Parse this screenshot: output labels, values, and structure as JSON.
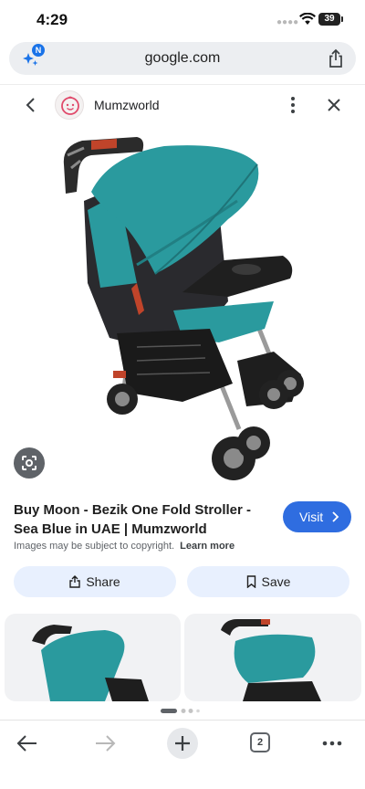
{
  "status_bar": {
    "time": "4:29",
    "battery": "39"
  },
  "address_bar": {
    "url": "google.com",
    "ai_badge": "N"
  },
  "panel": {
    "site_name": "Mumzworld"
  },
  "result": {
    "title": "Buy Moon - Bezik One Fold Stroller - Sea Blue in UAE | Mumzworld",
    "visit_label": "Visit",
    "copyright_notice": "Images may be subject to copyright.",
    "learn_more": "Learn more",
    "share_label": "Share",
    "save_label": "Save"
  },
  "toolbar": {
    "tab_count": "2"
  },
  "colors": {
    "accent": "#2f6de0",
    "pill": "#e8f0fe",
    "stroller_teal": "#2a9a9e"
  }
}
